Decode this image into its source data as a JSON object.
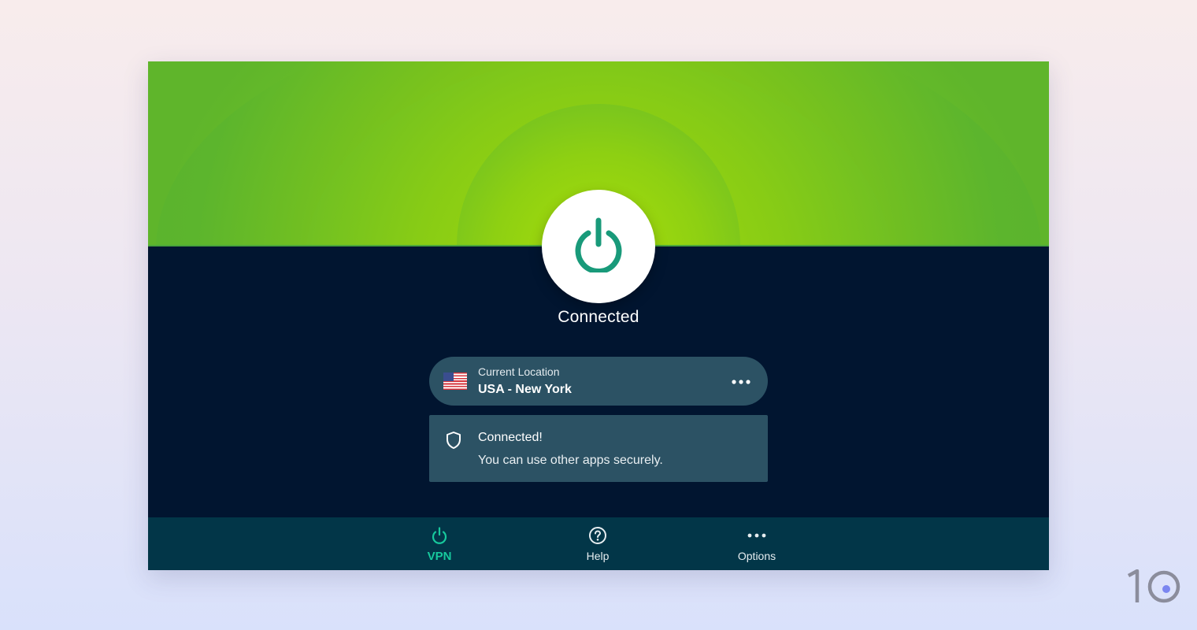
{
  "colors": {
    "accent_green": "#17c99d",
    "power_icon": "#199a7a",
    "background": "#011530",
    "card": "#2c5264",
    "nav_bar": "#023648"
  },
  "power_button": {
    "icon": "power-icon"
  },
  "status": {
    "text": "Connected"
  },
  "location": {
    "label": "Current Location",
    "value": "USA - New York",
    "flag": "us-flag-icon",
    "more_icon": "more-horizontal-icon"
  },
  "message": {
    "icon": "shield-icon",
    "title": "Connected!",
    "body": "You can use other apps securely."
  },
  "nav": {
    "items": [
      {
        "label": "VPN",
        "icon": "power-icon",
        "active": true
      },
      {
        "label": "Help",
        "icon": "help-circle-icon",
        "active": false
      },
      {
        "label": "Options",
        "icon": "more-horizontal-icon",
        "active": false
      }
    ]
  },
  "logo": {
    "text": "10"
  }
}
